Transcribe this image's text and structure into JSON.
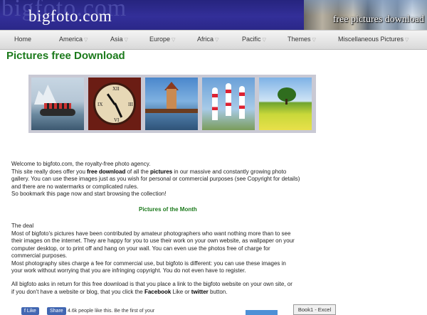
{
  "header": {
    "logo": "bigfoto.com",
    "tagline": "free pictures download"
  },
  "nav": {
    "items": [
      {
        "label": "Home",
        "dropdown": false
      },
      {
        "label": "America",
        "dropdown": true
      },
      {
        "label": "Asia",
        "dropdown": true
      },
      {
        "label": "Europe",
        "dropdown": true
      },
      {
        "label": "Africa",
        "dropdown": true
      },
      {
        "label": "Pacific",
        "dropdown": true
      },
      {
        "label": "Themes",
        "dropdown": true
      },
      {
        "label": "Miscellaneous Pictures",
        "dropdown": true
      }
    ]
  },
  "main": {
    "title": "Pictures free Download",
    "photos": [
      {
        "subject": "icebergs-boat"
      },
      {
        "subject": "clock"
      },
      {
        "subject": "tower-bridge"
      },
      {
        "subject": "air-race-pylons"
      },
      {
        "subject": "tree-field"
      }
    ],
    "intro": {
      "line1": "Welcome to bigfoto.com, the royalty-free photo agency.",
      "line2_a": "This site really does offer you ",
      "line2_b": "free download",
      "line2_c": " of all the ",
      "line2_d": "pictures",
      "line2_e": " in our massive and constantly growing photo",
      "line3": "gallery. You can use these images just as you wish for personal or commercial purposes (see Copyright for details)",
      "line4": "and there are no watermarks or complicated rules.",
      "line5": "So bookmark this page now and start browsing the collection!"
    },
    "pictures_of_month": "Pictures of the Month",
    "deal": {
      "heading": "The deal",
      "l1": "Most of bigfoto's pictures have been contributed by amateur photographers who want nothing more than to see",
      "l2": "their images on the internet. They are happy for you to use their work on your own website, as wallpaper on your",
      "l3": "computer desktop, or to print off and hang on your wall. You can even use the photos free of charge for",
      "l4": "commercial purposes.",
      "l5": "Most photography sites charge a fee for commercial use, but bigfoto is different: you can use these images in",
      "l6": "your work without worrying that you are infringing copyright. You do not even have to register."
    },
    "ask": {
      "l1": "All bigfoto asks in return for this free download is that you place a link to the bigfoto website on your own site, or",
      "l2_a": "if you don't have a website or blog, that you click the ",
      "l2_b": "Facebook",
      "l2_c": " Like or ",
      "l2_d": "twitter",
      "l2_e": " button."
    }
  },
  "social": {
    "like_label": "Like",
    "share_label": "Share",
    "count_text": "4.6k people like this. Be the first of your"
  },
  "taskbar": {
    "excel_tab": "Book1 - Excel"
  },
  "colors": {
    "banner": "#332f99",
    "title_green": "#1c7a1c",
    "facebook": "#4267b2"
  }
}
